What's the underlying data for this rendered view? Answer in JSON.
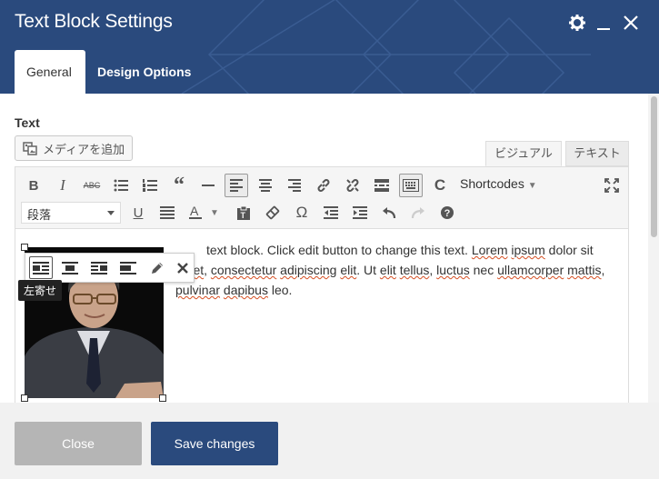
{
  "dialog": {
    "title": "Text Block Settings",
    "tabs": [
      {
        "label": "General",
        "active": true
      },
      {
        "label": "Design Options",
        "active": false
      }
    ]
  },
  "field": {
    "label": "Text"
  },
  "editor": {
    "add_media_label": "メディアを追加",
    "mode_tabs": {
      "visual": "ビジュアル",
      "text": "テキスト"
    },
    "shortcodes_label": "Shortcodes",
    "format_select_value": "段落",
    "image_tooltip": "左寄せ",
    "content": {
      "line1": "text block. Click edit button to change this text.",
      "w1": "Lorem",
      "w2": "ipsum",
      "w3": "dolor sit",
      "w4": "amet",
      "w5": "consectetur",
      "w6": "adipiscing",
      "w7": "elit",
      "w8": "Ut",
      "w9": "elit",
      "w10": "tellus",
      "w11": "luctus",
      "w12": "nec",
      "w13": "ullamcorper",
      "w14": "mattis",
      "w15": "pulvinar",
      "w16": "dapibus",
      "w17": "leo."
    }
  },
  "footer": {
    "close_label": "Close",
    "save_label": "Save changes"
  },
  "colors": {
    "brand": "#2a4a7d",
    "close_button": "#b5b5b5",
    "spellcheck": "#d54e21"
  }
}
